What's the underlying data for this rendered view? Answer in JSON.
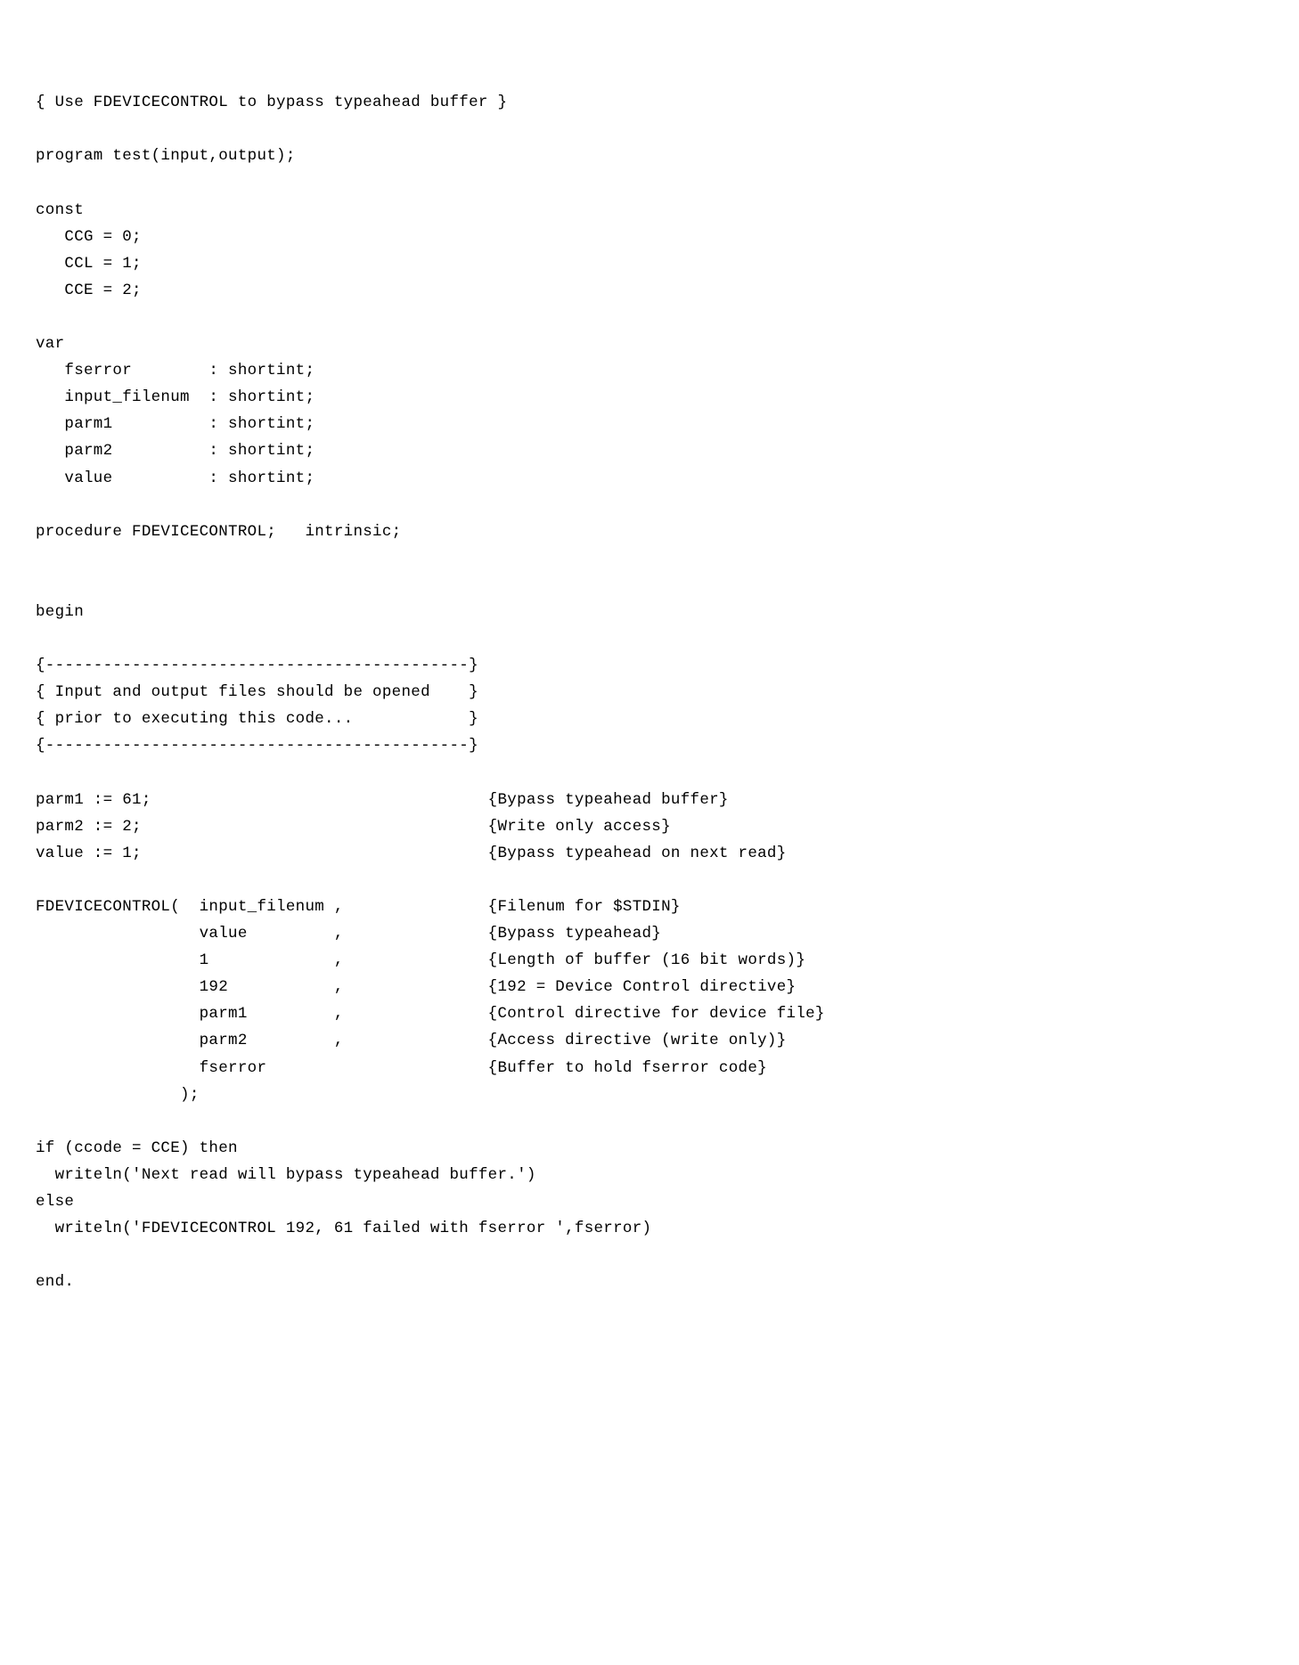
{
  "code": {
    "l01": "{ Use FDEVICECONTROL to bypass typeahead buffer }",
    "l02": "",
    "l03": "program test(input,output);",
    "l04": "",
    "l05": "const",
    "l06": "   CCG = 0;",
    "l07": "   CCL = 1;",
    "l08": "   CCE = 2;",
    "l09": "",
    "l10": "var",
    "l11": "   fserror        : shortint;",
    "l12": "   input_filenum  : shortint;",
    "l13": "   parm1          : shortint;",
    "l14": "   parm2          : shortint;",
    "l15": "   value          : shortint;",
    "l16": "",
    "l17": "procedure FDEVICECONTROL;   intrinsic;",
    "l18": "",
    "l19": "",
    "l20": "begin",
    "l21": "",
    "l22": "{--------------------------------------------}",
    "l23": "{ Input and output files should be opened    }",
    "l24": "{ prior to executing this code...            }",
    "l25": "{--------------------------------------------}",
    "l26": "",
    "l27": "parm1 := 61;                                   {Bypass typeahead buffer}",
    "l28": "parm2 := 2;                                    {Write only access}",
    "l29": "value := 1;                                    {Bypass typeahead on next read}",
    "l30": "",
    "l31": "FDEVICECONTROL(  input_filenum ,               {Filenum for $STDIN}",
    "l32": "                 value         ,               {Bypass typeahead}",
    "l33": "                 1             ,               {Length of buffer (16 bit words)}",
    "l34": "                 192           ,               {192 = Device Control directive}",
    "l35": "                 parm1         ,               {Control directive for device file}",
    "l36": "                 parm2         ,               {Access directive (write only)}",
    "l37": "                 fserror                       {Buffer to hold fserror code}",
    "l38": "               );",
    "l39": "",
    "l40": "if (ccode = CCE) then",
    "l41": "  writeln('Next read will bypass typeahead buffer.')",
    "l42": "else",
    "l43": "  writeln('FDEVICECONTROL 192, 61 failed with fserror ',fserror)",
    "l44": "",
    "l45": "end."
  }
}
